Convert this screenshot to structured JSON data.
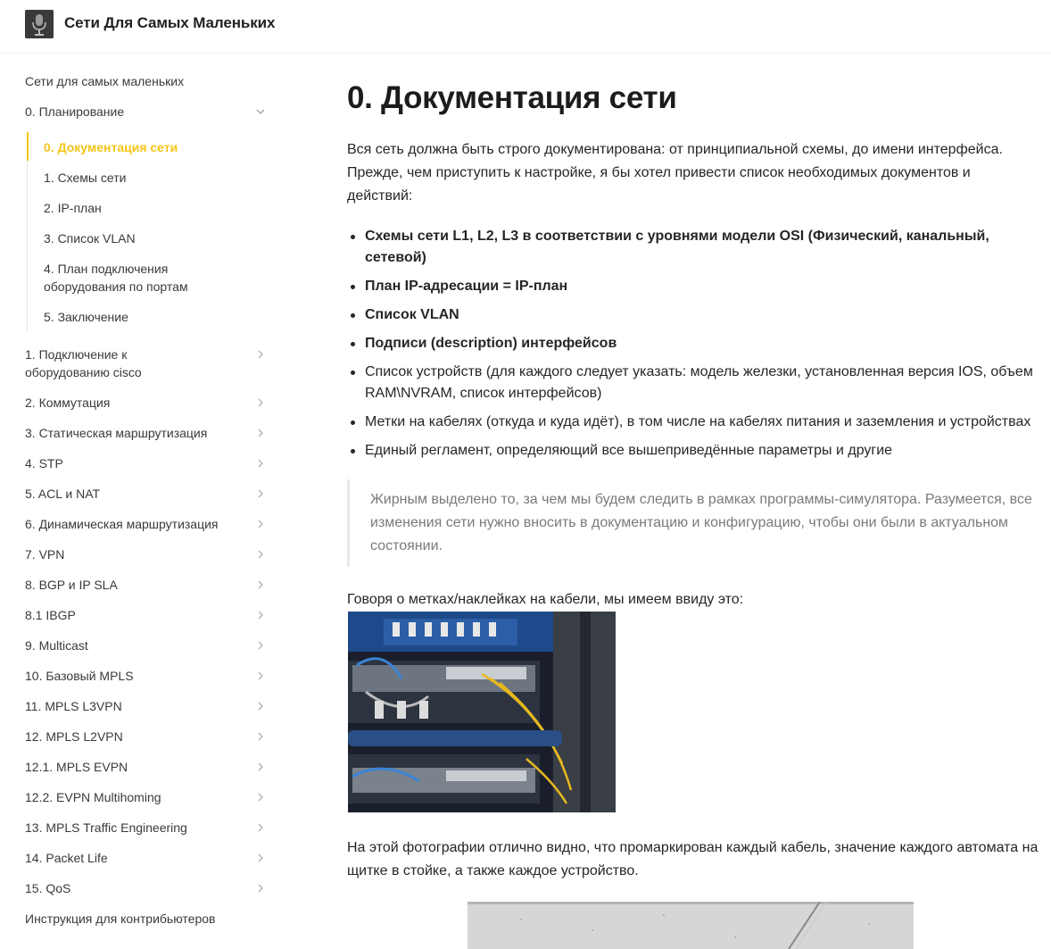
{
  "header": {
    "site_title": "Сети Для Самых Маленьких",
    "logo_icon": "microphone-logo-icon"
  },
  "sidebar": {
    "root": "Сети для самых маленьких",
    "planning": "0. Планирование",
    "planning_children": [
      "0. Документация сети",
      "1. Схемы сети",
      "2. IP-план",
      "3. Список VLAN",
      "4. План подключения оборудования по портам",
      "5. Заключение"
    ],
    "sections": [
      "1. Подключение к оборудованию cisco",
      "2. Коммутация",
      "3. Статическая маршрутизация",
      "4. STP",
      "5. ACL и NAT",
      "6. Динамическая маршрутизация",
      "7. VPN",
      "8. BGP и IP SLA",
      "8.1 IBGP",
      "9. Multicast",
      "10. Базовый MPLS",
      "11. MPLS L3VPN",
      "12. MPLS L2VPN",
      "12.1. MPLS EVPN",
      "12.2. EVPN Multihoming",
      "13. MPLS Traffic Engineering",
      "14. Packet Life",
      "15. QoS"
    ],
    "contributors": "Инструкция для контрибьютеров",
    "accent_color": "#f5c518"
  },
  "main": {
    "title": "0. Документация сети",
    "intro": "Вся сеть должна быть строго документирована: от принципиальной схемы, до имени интерфейса. Прежде, чем приступить к настройке, я бы хотел привести список необходимых документов и действий:",
    "list": [
      "Схемы сети L1, L2, L3 в соответствии с уровнями модели OSI (Физический, канальный, сетевой)",
      "План IP-адресации = IP-план",
      "Список VLAN",
      "Подписи (description) интерфейсов",
      "Список устройств (для каждого следует указать: модель железки, установленная версия IOS, объем RAM\\NVRAM, список интерфейсов)",
      "Метки на кабелях (откуда и куда идёт), в том числе на кабелях питания и заземления и устройствах",
      "Единый регламент, определяющий все вышеприведённые параметры и другие"
    ],
    "quote": "Жирным выделено то, за чем мы будем следить в рамках программы-симулятора. Разумеется, все изменения сети нужно вносить в документацию и конфигурацию, чтобы они были в актуальном состоянии.",
    "p1": "Говоря о метках/наклейках на кабели, мы имеем ввиду это:",
    "p2": "На этой фотографии отлично видно, что промаркирован каждый кабель, значение каждого автомата на щитке в стойке, а также каждое устройство."
  }
}
